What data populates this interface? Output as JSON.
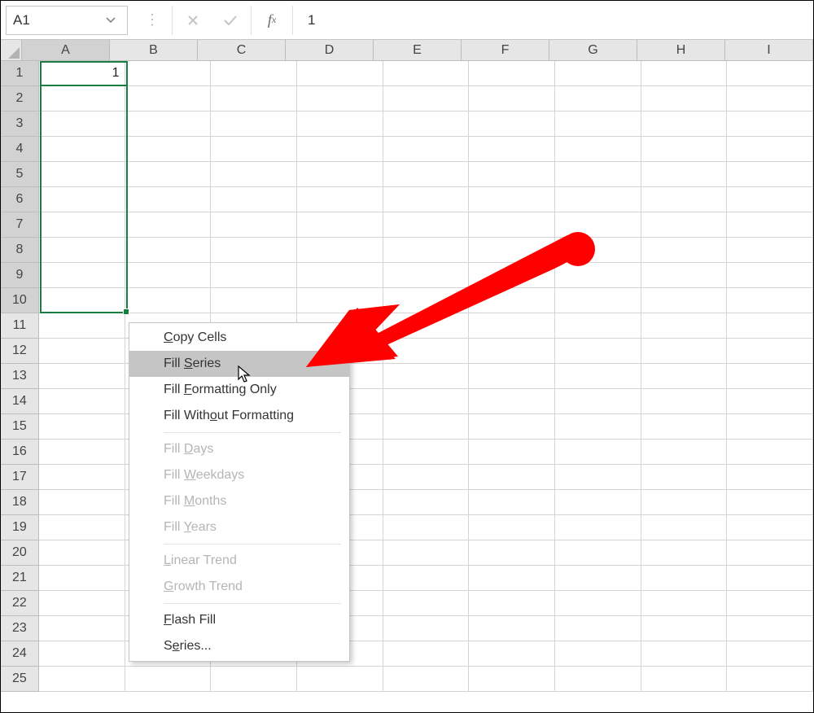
{
  "namebox": {
    "ref": "A1"
  },
  "formula_bar": {
    "value": "1"
  },
  "columns": [
    "A",
    "B",
    "C",
    "D",
    "E",
    "F",
    "G",
    "H",
    "I"
  ],
  "rows": [
    1,
    2,
    3,
    4,
    5,
    6,
    7,
    8,
    9,
    10,
    11,
    12,
    13,
    14,
    15,
    16,
    17,
    18,
    19,
    20,
    21,
    22,
    23,
    24,
    25
  ],
  "selected_column": "A",
  "selected_rows": [
    1,
    2,
    3,
    4,
    5,
    6,
    7,
    8,
    9,
    10
  ],
  "cells": {
    "A1": "1"
  },
  "context_menu": {
    "items": [
      {
        "key": "copy_cells",
        "label_pre": "",
        "hot": "C",
        "label_post": "opy Cells",
        "disabled": false
      },
      {
        "key": "fill_series",
        "label_pre": "Fill ",
        "hot": "S",
        "label_post": "eries",
        "disabled": false,
        "hover": true
      },
      {
        "key": "fill_formatting_only",
        "label_pre": "Fill ",
        "hot": "F",
        "label_post": "ormatting Only",
        "disabled": false
      },
      {
        "key": "fill_without_formatting",
        "label_pre": "Fill With",
        "hot": "o",
        "label_post": "ut Formatting",
        "disabled": false
      },
      {
        "sep": true
      },
      {
        "key": "fill_days",
        "label_pre": "Fill ",
        "hot": "D",
        "label_post": "ays",
        "disabled": true
      },
      {
        "key": "fill_weekdays",
        "label_pre": "Fill ",
        "hot": "W",
        "label_post": "eekdays",
        "disabled": true
      },
      {
        "key": "fill_months",
        "label_pre": "Fill ",
        "hot": "M",
        "label_post": "onths",
        "disabled": true
      },
      {
        "key": "fill_years",
        "label_pre": "Fill ",
        "hot": "Y",
        "label_post": "ears",
        "disabled": true
      },
      {
        "sep": true
      },
      {
        "key": "linear_trend",
        "label_pre": "",
        "hot": "L",
        "label_post": "inear Trend",
        "disabled": true
      },
      {
        "key": "growth_trend",
        "label_pre": "",
        "hot": "G",
        "label_post": "rowth Trend",
        "disabled": true
      },
      {
        "sep": true
      },
      {
        "key": "flash_fill",
        "label_pre": "",
        "hot": "F",
        "label_post": "lash Fill",
        "disabled": false
      },
      {
        "key": "series",
        "label_pre": "S",
        "hot": "e",
        "label_post": "ries...",
        "disabled": false
      }
    ]
  }
}
